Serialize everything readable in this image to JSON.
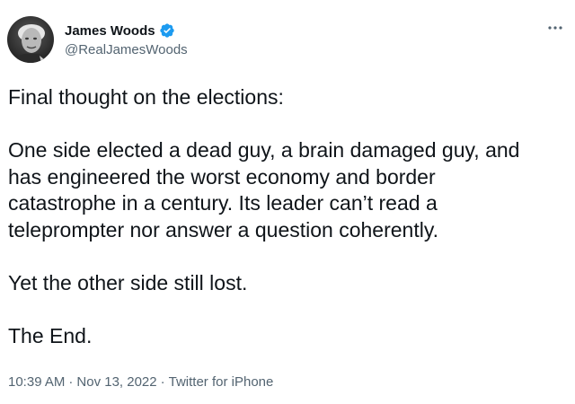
{
  "author": {
    "display_name": "James Woods",
    "handle": "@RealJamesWoods",
    "verified_icon": "verified-badge-icon"
  },
  "more_icon": "more-options-icon",
  "tweet": {
    "intro": "Final thought on the elections:",
    "line1": "One side elected a dead guy, a brain damaged guy, and",
    "line2": "has engineered the worst economy and border",
    "line3": "catastrophe in a century. Its leader can’t read a",
    "line4": "teleprompter nor answer a question coherently.",
    "para3": "Yet the other side still lost.",
    "para4": "The End."
  },
  "meta": {
    "time": "10:39 AM",
    "separator": "·",
    "date": "Nov 13, 2022",
    "source": "Twitter for iPhone"
  },
  "colors": {
    "text": "#0f1419",
    "muted": "#536471",
    "verified": "#1d9bf0"
  }
}
